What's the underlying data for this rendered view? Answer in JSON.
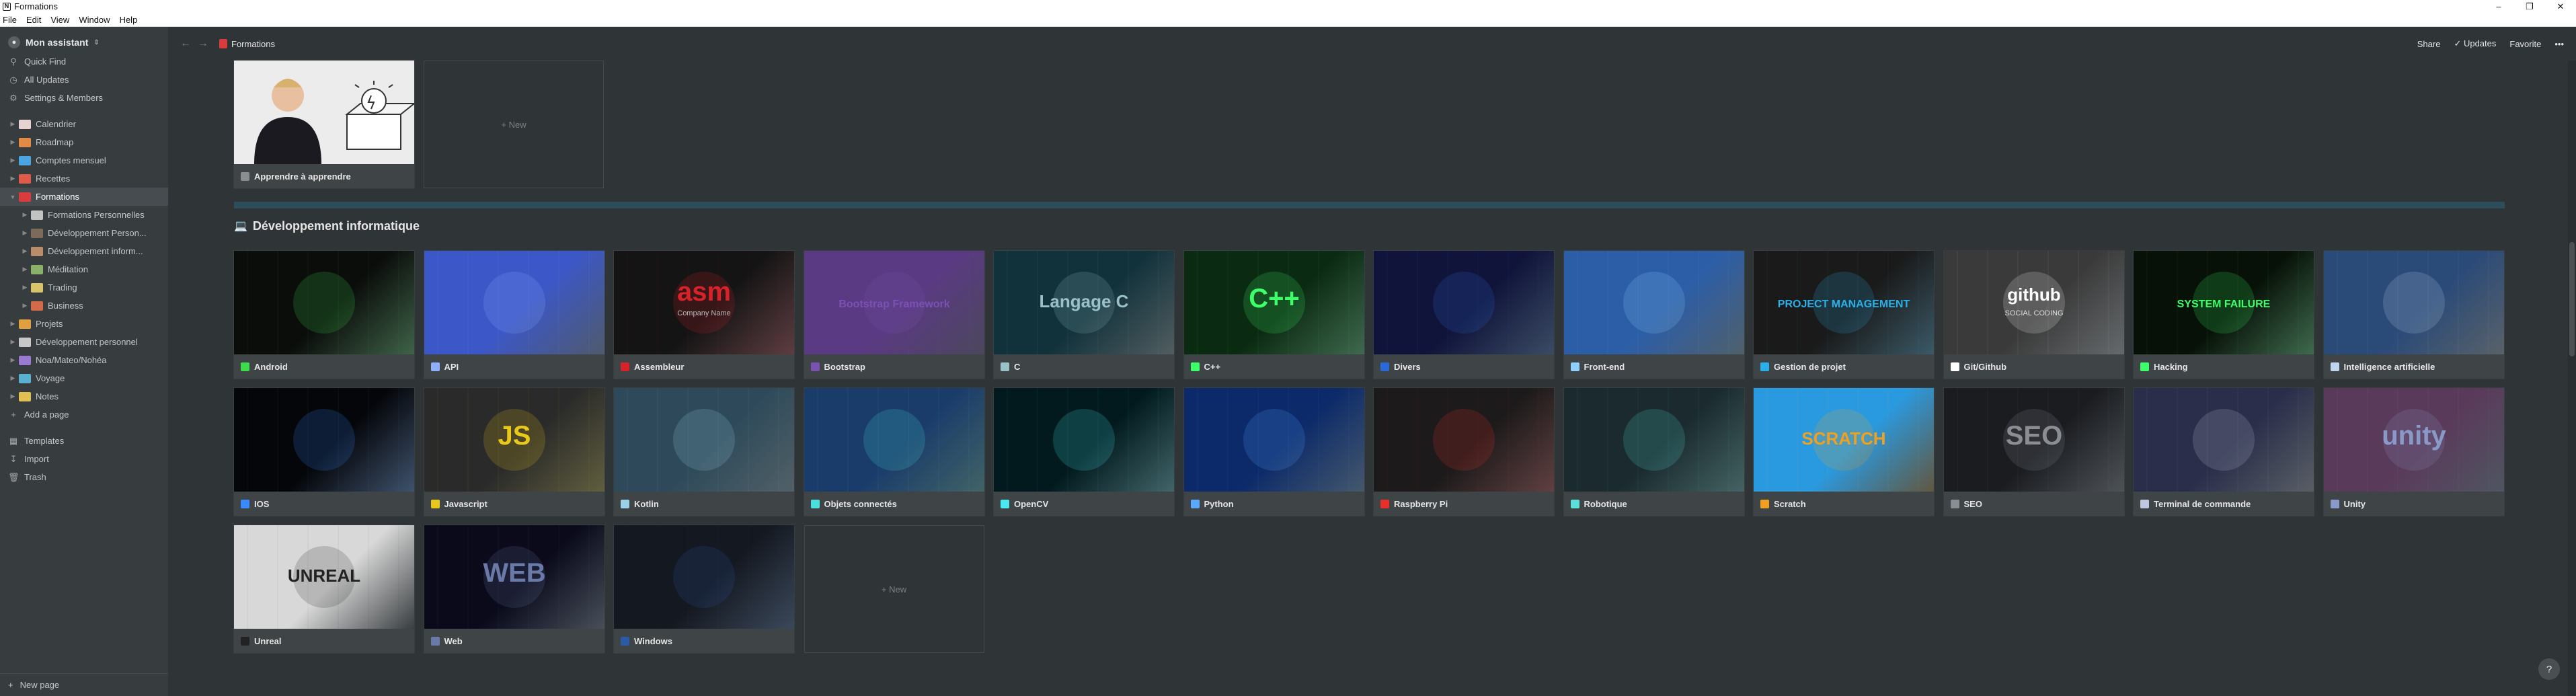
{
  "window": {
    "title": "Formations",
    "menus": [
      "File",
      "Edit",
      "View",
      "Window",
      "Help"
    ]
  },
  "workspace": {
    "name": "Mon assistant"
  },
  "sidebar": {
    "top_items": [
      {
        "label": "Quick Find",
        "icon": "search-icon"
      },
      {
        "label": "All Updates",
        "icon": "clock-icon"
      },
      {
        "label": "Settings & Members",
        "icon": "gear-icon"
      }
    ],
    "pages": [
      {
        "label": "Calendrier",
        "level": 0,
        "color": "#e8d3d3"
      },
      {
        "label": "Roadmap",
        "level": 0,
        "color": "#e38b45"
      },
      {
        "label": "Comptes mensuel",
        "level": 0,
        "color": "#4aa5e0"
      },
      {
        "label": "Recettes",
        "level": 0,
        "color": "#e05a4a"
      },
      {
        "label": "Formations",
        "level": 0,
        "color": "#d83c3c",
        "selected": true,
        "expanded": true
      },
      {
        "label": "Formations Personnelles",
        "level": 1,
        "color": "#c2c2c2"
      },
      {
        "label": "Développement Person...",
        "level": 1,
        "color": "#7d6a5a"
      },
      {
        "label": "Développement inform...",
        "level": 1,
        "color": "#b98c6a"
      },
      {
        "label": "Méditation",
        "level": 1,
        "color": "#8ab06a"
      },
      {
        "label": "Trading",
        "level": 1,
        "color": "#d8c26a"
      },
      {
        "label": "Business",
        "level": 1,
        "color": "#d46a4a"
      },
      {
        "label": "Projets",
        "level": 0,
        "color": "#e0a040"
      },
      {
        "label": "Développement personnel",
        "level": 0,
        "color": "#c8c8c8"
      },
      {
        "label": "Noa/Mateo/Nohéa",
        "level": 0,
        "color": "#9a7ad0"
      },
      {
        "label": "Voyage",
        "level": 0,
        "color": "#5ab0d0"
      },
      {
        "label": "Notes",
        "level": 0,
        "color": "#e0c050"
      }
    ],
    "add_page": "Add a page",
    "bottom_items": [
      {
        "label": "Templates",
        "icon": "templates-icon"
      },
      {
        "label": "Import",
        "icon": "import-icon"
      },
      {
        "label": "Trash",
        "icon": "trash-icon"
      }
    ],
    "new_page": "New page"
  },
  "topbar": {
    "breadcrumb": "Formations",
    "share": "Share",
    "updates": "Updates",
    "favorite": "Favorite",
    "more": "•••"
  },
  "top_cards": [
    {
      "title": "Apprendre à apprendre"
    }
  ],
  "new_label": "New",
  "section_title": "Développement informatique",
  "cards": [
    {
      "title": "Android",
      "bg": "#0b0d0b",
      "accent": "#3ddc4b"
    },
    {
      "title": "API",
      "bg": "#3c58c8",
      "accent": "#8fb0ff"
    },
    {
      "title": "Assembleur",
      "bg": "#141414",
      "accent": "#d8222a",
      "text": "asm",
      "sub": "Company Name"
    },
    {
      "title": "Bootstrap",
      "bg": "#5a3a82",
      "accent": "#7a52b3",
      "text": "Bootstrap Framework"
    },
    {
      "title": "C",
      "bg": "#12323b",
      "accent": "#9ac0c8",
      "text": "Langage C"
    },
    {
      "title": "C++",
      "bg": "#0b2a12",
      "accent": "#3dff6a",
      "text": "C++"
    },
    {
      "title": "Divers",
      "bg": "#10143a",
      "accent": "#2a6ad8"
    },
    {
      "title": "Front-end",
      "bg": "#2c5ea8",
      "accent": "#8fd0ff"
    },
    {
      "title": "Gestion de projet",
      "bg": "#1a1a1a",
      "accent": "#2ab0e8",
      "text": "PROJECT MANAGEMENT"
    },
    {
      "title": "Git/Github",
      "bg": "#3a3a3a",
      "accent": "#ffffff",
      "text": "github",
      "sub": "SOCIAL CODING"
    },
    {
      "title": "Hacking",
      "bg": "#071107",
      "accent": "#3dff6a",
      "text": "SYSTEM FAILURE"
    },
    {
      "title": "Intelligence artificielle",
      "bg": "#2a4a78",
      "accent": "#c0d6f0"
    },
    {
      "title": "IOS",
      "bg": "#05060a",
      "accent": "#3a8aff"
    },
    {
      "title": "Javascript",
      "bg": "#2a2a2a",
      "accent": "#e8c81a",
      "text": "JS"
    },
    {
      "title": "Kotlin",
      "bg": "#2e4a5a",
      "accent": "#9ad0e8"
    },
    {
      "title": "Objets connectés",
      "bg": "#1a3c6a",
      "accent": "#4ae0e0"
    },
    {
      "title": "OpenCV",
      "bg": "#021a1e",
      "accent": "#4ae8f0"
    },
    {
      "title": "Python",
      "bg": "#0c2a6a",
      "accent": "#5aa8ff"
    },
    {
      "title": "Raspberry Pi",
      "bg": "#1c1a1a",
      "accent": "#e8302a"
    },
    {
      "title": "Robotique",
      "bg": "#1a2a2e",
      "accent": "#5ae0d8"
    },
    {
      "title": "Scratch",
      "bg": "#2a9ae0",
      "accent": "#f0a020",
      "text": "SCRATCH"
    },
    {
      "title": "SEO",
      "bg": "#1a1c20",
      "accent": "#8a8e94",
      "text": "SEO"
    },
    {
      "title": "Terminal de commande",
      "bg": "#2a2e4a",
      "accent": "#c0c8e0"
    },
    {
      "title": "Unity",
      "bg": "#5a3a5a",
      "accent": "#8a9ac8",
      "text": "unity"
    },
    {
      "title": "Unreal",
      "bg": "#d8d8d8",
      "accent": "#222222",
      "text": "UNREAL"
    },
    {
      "title": "Web",
      "bg": "#0a0a1a",
      "accent": "#6a7aa8",
      "text": "WEB"
    },
    {
      "title": "Windows",
      "bg": "#141820",
      "accent": "#2a5aa8"
    }
  ],
  "help_label": "?"
}
